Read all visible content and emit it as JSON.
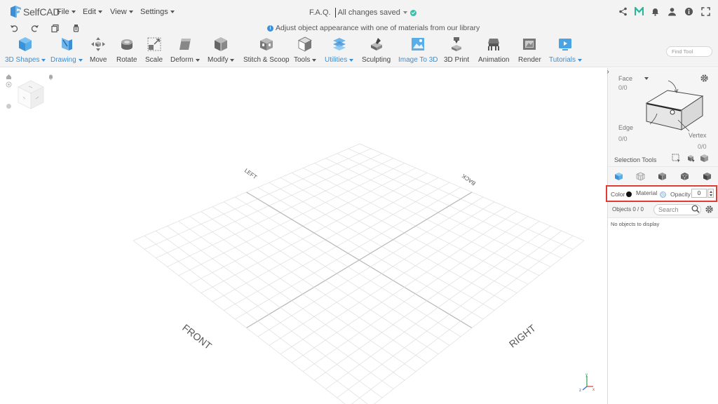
{
  "app": {
    "brand": "SelfCAD",
    "accent_color": "#3a8fd6",
    "highlight_color": "#e53935"
  },
  "menu": {
    "items": [
      {
        "label": "File"
      },
      {
        "label": "Edit"
      },
      {
        "label": "View"
      },
      {
        "label": "Settings"
      }
    ]
  },
  "document": {
    "title": "F.A.Q.",
    "save_status": "All changes saved"
  },
  "header_icons": [
    "share-icon",
    "m-logo-icon",
    "bell-icon",
    "user-icon",
    "info-icon",
    "fullscreen-icon"
  ],
  "actionbar": {
    "icons": [
      "undo-icon",
      "redo-icon",
      "copy-icon",
      "paint-icon"
    ],
    "hint": "Adjust object appearance with one of materials from our library"
  },
  "toolbar": {
    "tools": [
      {
        "label": "3D Shapes",
        "dropdown": true,
        "active": true,
        "icon": "cube-icon"
      },
      {
        "label": "Drawing",
        "dropdown": true,
        "active": true,
        "icon": "drawing-icon"
      },
      {
        "label": "Move",
        "dropdown": false,
        "active": false,
        "icon": "move-icon"
      },
      {
        "label": "Rotate",
        "dropdown": false,
        "active": false,
        "icon": "rotate-icon"
      },
      {
        "label": "Scale",
        "dropdown": false,
        "active": false,
        "icon": "scale-icon"
      },
      {
        "label": "Deform",
        "dropdown": true,
        "active": false,
        "icon": "deform-icon"
      },
      {
        "label": "Modify",
        "dropdown": true,
        "active": false,
        "icon": "modify-icon"
      },
      {
        "label": "Stitch & Scoop",
        "dropdown": false,
        "active": false,
        "icon": "stitch-scoop-icon"
      },
      {
        "label": "Tools",
        "dropdown": true,
        "active": false,
        "icon": "tools-icon"
      },
      {
        "label": "Utilities",
        "dropdown": true,
        "active": true,
        "icon": "utilities-icon"
      },
      {
        "label": "Sculpting",
        "dropdown": false,
        "active": false,
        "icon": "sculpting-icon"
      },
      {
        "label": "Image To 3D",
        "dropdown": false,
        "active": true,
        "icon": "image-to-3d-icon"
      },
      {
        "label": "3D Print",
        "dropdown": false,
        "active": false,
        "icon": "3d-print-icon"
      },
      {
        "label": "Animation",
        "dropdown": false,
        "active": false,
        "icon": "animation-icon"
      },
      {
        "label": "Render",
        "dropdown": false,
        "active": false,
        "icon": "render-icon"
      },
      {
        "label": "Tutorials",
        "dropdown": true,
        "active": true,
        "icon": "tutorials-icon"
      }
    ],
    "find_placeholder": "Find Tool"
  },
  "viewport": {
    "labels": {
      "front": "FRONT",
      "right": "RIGHT",
      "left": "LEFT",
      "back": "BACK"
    },
    "axes": {
      "x": "x",
      "y": "y",
      "z": "z"
    }
  },
  "selection": {
    "face": {
      "label": "Face",
      "count": "0/0"
    },
    "edge": {
      "label": "Edge",
      "count": "0/0"
    },
    "vertex": {
      "label": "Vertex",
      "count": "0/0"
    },
    "tools_label": "Selection Tools"
  },
  "appearance": {
    "color_label": "Color",
    "color_value": "#111111",
    "material_label": "Material",
    "opacity_label": "Opacity",
    "opacity_value": "0"
  },
  "objects": {
    "count_label": "Objects 0 / 0",
    "search_placeholder": "Search",
    "empty_message": "No objects to display"
  }
}
